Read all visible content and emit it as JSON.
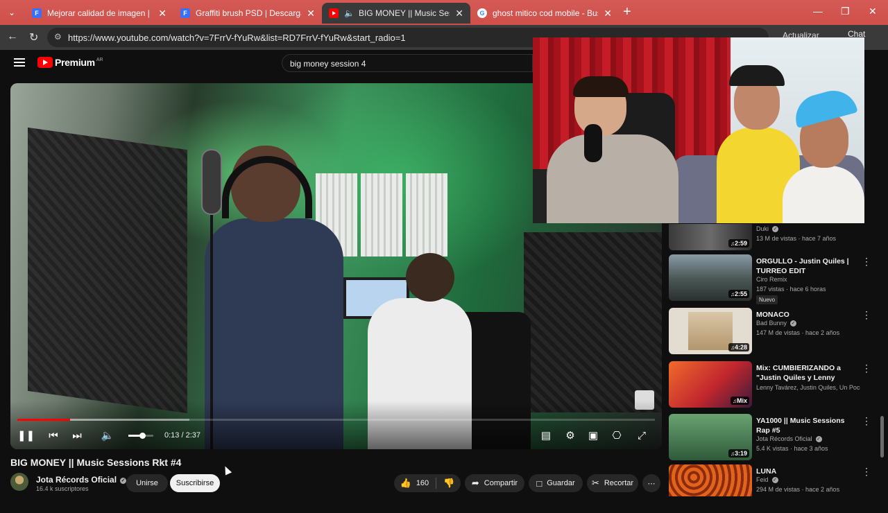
{
  "browser": {
    "tabs": [
      {
        "title": "Mejorar calidad de imagen | Freep",
        "favicon": "F",
        "favicon_color": "#3a6ff7"
      },
      {
        "title": "Graffiti brush PSD | Descarga gratu",
        "favicon": "F",
        "favicon_color": "#3a6ff7"
      },
      {
        "title": "BIG MONEY || Music Sessions",
        "favicon": "yt",
        "favicon_color": "#ff0000",
        "active": true,
        "audio": true
      },
      {
        "title": "ghost mitico cod mobile - Buscar c",
        "favicon": "G",
        "favicon_color": "#ffffff"
      }
    ],
    "url": "https://www.youtube.com/watch?v=7FrrV-fYuRw&list=RD7FrrV-fYuRw&start_radio=1",
    "update_label": "Actualizar",
    "chat_label": "Chat"
  },
  "youtube": {
    "logo_text": "Premium",
    "country_code": "AR",
    "search_query": "big money session 4"
  },
  "player": {
    "time_current": "0:13",
    "time_total": "2:37",
    "played_fraction": 0.083,
    "buffered_fraction": 0.27,
    "volume_fraction": 0.55
  },
  "video": {
    "title": "BIG MONEY || Music Sessions Rkt #4",
    "channel": "Jota Récords Oficial",
    "subscribers": "16.4 k suscriptores",
    "join_label": "Unirse",
    "subscribe_label": "Suscribirse",
    "likes": "160",
    "share_label": "Compartir",
    "save_label": "Guardar",
    "clip_label": "Recortar"
  },
  "recommendations": [
    {
      "title": "",
      "channel": "Duki",
      "verified": true,
      "meta": "13 M de vistas · hace 7 años",
      "duration": "2:59",
      "thumb": "#4a4a4a"
    },
    {
      "title": "ORGULLO - Justin Quiles | TURREO EDIT",
      "channel": "Ciro Remix",
      "verified": false,
      "meta": "187 vistas · hace 6 horas",
      "duration": "2:55",
      "badge": "Nuevo",
      "thumb": "#5f6a6e"
    },
    {
      "title": "MONACO",
      "channel": "Bad Bunny",
      "verified": true,
      "meta": "147 M de vistas · hace 2 años",
      "duration": "4:28",
      "thumb": "#d9d4c7"
    },
    {
      "title": "Mix: CUMBIERIZANDO a \"Justin Quiles y Lenny Tavarez\" / UN ...",
      "channel": "Lenny Tavárez, Justin Quiles, Un Poco de...",
      "verified": false,
      "meta": "",
      "duration": "Mix",
      "thumb": "#c0262e"
    },
    {
      "title": "YA1000 || Music Sessions Rap #5",
      "channel": "Jota Récords Oficial",
      "verified": true,
      "meta": "5.4 K vistas · hace 3 años",
      "duration": "3:19",
      "thumb": "#3c6f4a"
    },
    {
      "title": "LUNA",
      "channel": "Feid",
      "verified": true,
      "meta": "294 M de vistas · hace 2 años",
      "duration": "",
      "thumb": "#d45a1f"
    }
  ]
}
